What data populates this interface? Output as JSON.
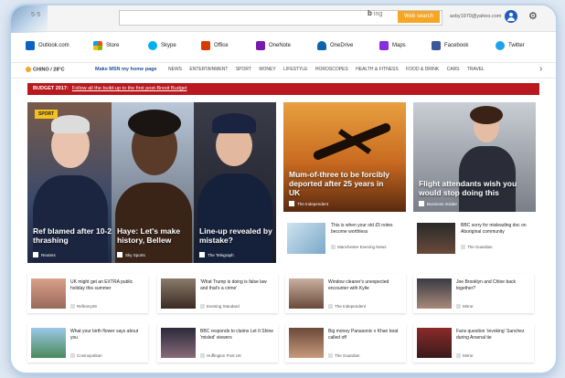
{
  "browser": {
    "brand_text": "5·5",
    "search_button": "Web search",
    "bing": "b",
    "bing_suffix": "ing",
    "account_email": "axby1970@yahoo.com"
  },
  "apps": [
    {
      "label": "Outlook.com",
      "color": "#0b61c4"
    },
    {
      "label": "Store",
      "color": "#f25022"
    },
    {
      "label": "Skype",
      "color": "#00aff0"
    },
    {
      "label": "Office",
      "color": "#d83b01"
    },
    {
      "label": "OneNote",
      "color": "#7719aa"
    },
    {
      "label": "OneDrive",
      "color": "#0a64ad"
    },
    {
      "label": "Maps",
      "color": "#8a2be2"
    },
    {
      "label": "Facebook",
      "color": "#3b5998"
    },
    {
      "label": "Twitter",
      "color": "#1da1f2"
    }
  ],
  "nav": {
    "weather": "CHINO / 28°C",
    "set_home": "Make MSN my home page",
    "items": [
      "NEWS",
      "ENTERTAINMENT",
      "SPORT",
      "MONEY",
      "LIFESTYLE",
      "HOROSCOPES",
      "HEALTH & FITNESS",
      "FOOD & DRINK",
      "CARS",
      "TRAVEL"
    ]
  },
  "banner": {
    "label": "BUDGET 2017:",
    "text": "Follow all the build-up to the first post-Brexit Budget"
  },
  "hero": [
    {
      "caption": "Ref blamed after 10-2 thrashing",
      "source": "Reuters",
      "tag": "SPORT"
    },
    {
      "caption": "Haye: Let's make history, Bellew",
      "source": "Sky Sports"
    },
    {
      "caption": "Line-up revealed by mistake?",
      "source": "The Telegraph"
    },
    {
      "caption": "Mum-of-three to be forcibly deported after 25 years in UK",
      "source": "The Independent"
    },
    {
      "caption": "Flight attendants wish you would stop doing this",
      "source": "Business Insider"
    }
  ],
  "mid_cards": [
    {
      "title": "This is when your old £5 notes become worthless",
      "source": "Manchester Evening News"
    },
    {
      "title": "BBC sorry for misleading doc on Aboriginal community",
      "source": "The Guardian"
    }
  ],
  "row1": [
    {
      "title": "UK might get an EXTRA public holiday this summer",
      "source": "Refinery29"
    },
    {
      "title": "'What Trump is doing is false law and that's a crime'",
      "source": "Evening Standard"
    },
    {
      "title": "Window cleaner's unexpected encounter with Kylie",
      "source": "The Independent"
    },
    {
      "title": "Joe Brooklyn and Chloe back together?",
      "source": "Mirror"
    }
  ],
  "row2": [
    {
      "title": "What your birth flower says about you",
      "source": "Cosmopolitan"
    },
    {
      "title": "BBC responds to claims Let It Shine 'misled' viewers",
      "source": "Huffington Post UK"
    },
    {
      "title": "Big money Panasonic x Khan boat called off",
      "source": "The Guardian"
    },
    {
      "title": "Fans question 'revoking' Sanchez during Arsenal tie",
      "source": "Mirror"
    }
  ]
}
